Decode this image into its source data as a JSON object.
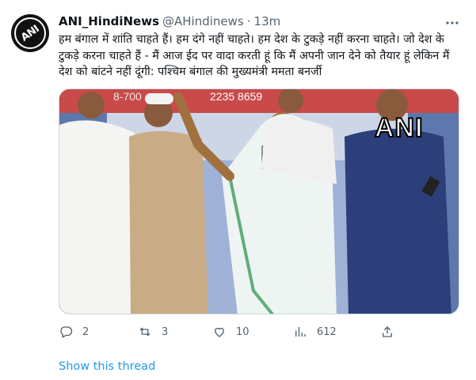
{
  "tweet": {
    "display_name": "ANI_HindiNews",
    "handle": "@AHindinews",
    "separator": "·",
    "timestamp": "13m",
    "more_icon": "more-dots-icon",
    "text": "हम बंगाल में शांति चाहते हैं। हम दंगे नहीं चाहते। हम देश के टुकड़े नहीं करना चाहते। जो देश के टुकड़े करना चाहते हैं - मैं आज ईद पर वादा करती हूं कि मैं अपनी जान देने को तैयार हूं लेकिन मैं देश को बांटने नहीं दूंगी: पश्चिम बंगाल की मुख्यमंत्री ममता बनर्जी",
    "avatar_text": "ANI",
    "media": {
      "watermark": "ANI",
      "banner_text_left": "8-700",
      "banner_text_right": "2235 8659"
    },
    "actions": {
      "reply_count": "2",
      "retweet_count": "3",
      "like_count": "10",
      "views_count": "612"
    },
    "show_thread": "Show this thread"
  },
  "colors": {
    "accent": "#1d9bf0",
    "secondary_text": "#536471",
    "primary_text": "#0f1419"
  }
}
